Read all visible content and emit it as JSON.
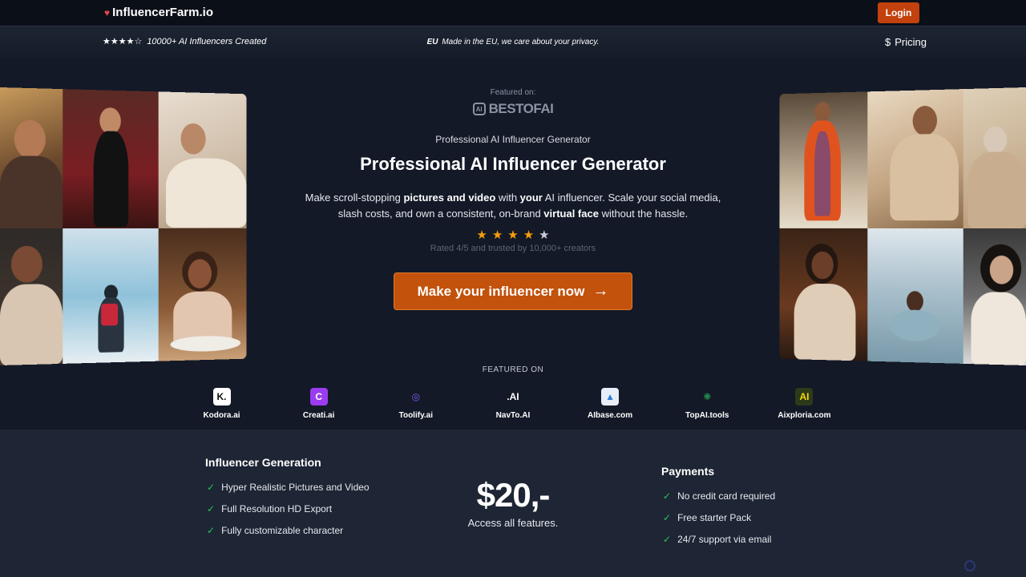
{
  "nav": {
    "brand": "InfluencerFarm.io",
    "login_label": "Login"
  },
  "subbar": {
    "stars": "★★★★☆",
    "created_text": "10000+ AI Influencers Created",
    "privacy_prefix": "EU",
    "privacy_text": "Made in the EU, we care about your privacy.",
    "pricing_symbol": "$",
    "pricing_label": "Pricing"
  },
  "hero": {
    "featured_on": "Featured on:",
    "bestofai_badge": "AI",
    "bestofai_name": "BESTOFAI",
    "eyebrow": "Professional AI Influencer Generator",
    "title": "Professional AI Influencer Generator",
    "desc_1": "Make scroll-stopping ",
    "desc_b1": "pictures and video",
    "desc_2": " with ",
    "desc_b2": "your",
    "desc_3": " AI influencer. Scale your social media, slash costs, and own a consistent, on-brand ",
    "desc_b3": "virtual face",
    "desc_4": " without the hassle.",
    "rating_value": 4,
    "rating_max": 5,
    "rated_text": "Rated 4/5 and trusted by 10,000+ creators",
    "cta_label": "Make your influencer now",
    "cta_arrow": "→"
  },
  "featured": {
    "label": "FEATURED ON",
    "items": [
      {
        "name": "Kodora.ai",
        "mark": "K.",
        "bg": "#ffffff",
        "fg": "#111111"
      },
      {
        "name": "Creati.ai",
        "mark": "C",
        "bg": "#9b3cf0",
        "fg": "#ffffff"
      },
      {
        "name": "Toolify.ai",
        "mark": "◎",
        "bg": "transparent",
        "fg": "#7c5cf5"
      },
      {
        "name": "NavTo.AI",
        "mark": ".AI",
        "bg": "transparent",
        "fg": "#ffffff"
      },
      {
        "name": "AIbase.com",
        "mark": "▲",
        "bg": "#e8eef7",
        "fg": "#2f7ed8"
      },
      {
        "name": "TopAI.tools",
        "mark": "✺",
        "bg": "transparent",
        "fg": "#1f8a4c"
      },
      {
        "name": "Aixploria.com",
        "mark": "AI",
        "bg": "#2d3a1a",
        "fg": "#f5d90a"
      }
    ]
  },
  "generation": {
    "title": "Influencer Generation",
    "items": [
      "Hyper Realistic Pictures and Video",
      "Full Resolution HD Export",
      "Fully customizable character"
    ]
  },
  "pricing": {
    "price": "$20,-",
    "sub": "Access all features."
  },
  "payments": {
    "title": "Payments",
    "items": [
      "No credit card required",
      "Free starter Pack",
      "24/7 support via email"
    ]
  }
}
